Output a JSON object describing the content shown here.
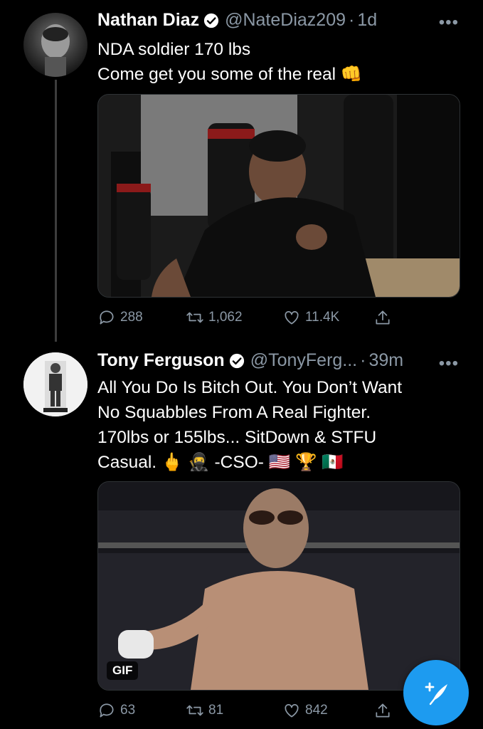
{
  "tweets": [
    {
      "name": "Nathan Diaz",
      "handle": "@NateDiaz209",
      "time": "1d",
      "text_lines": [
        "NDA soldier 170 lbs",
        "Come get you some of the real 👊"
      ],
      "media_type": "image",
      "replies": "288",
      "retweets": "1,062",
      "likes": "11.4K"
    },
    {
      "name": "Tony Ferguson",
      "handle": "@TonyFerg...",
      "time": "39m",
      "text_lines": [
        "All You Do Is Bitch Out. You Don’t Want",
        "No Squabbles From A Real Fighter.",
        "170lbs or 155lbs... SitDown & STFU",
        "Casual. 🖕 🥷 -CSO- 🇺🇸 🏆 🇲🇽"
      ],
      "media_type": "gif",
      "media_badge": "GIF",
      "replies": "63",
      "retweets": "81",
      "likes": "842"
    }
  ],
  "icons": {
    "verified": "verified-badge-icon",
    "reply": "reply-icon",
    "retweet": "retweet-icon",
    "like": "heart-icon",
    "share": "share-icon",
    "compose": "compose-tweet-icon"
  },
  "colors": {
    "background": "#000000",
    "secondary_text": "#8b98a5",
    "accent": "#1d9bf0"
  }
}
